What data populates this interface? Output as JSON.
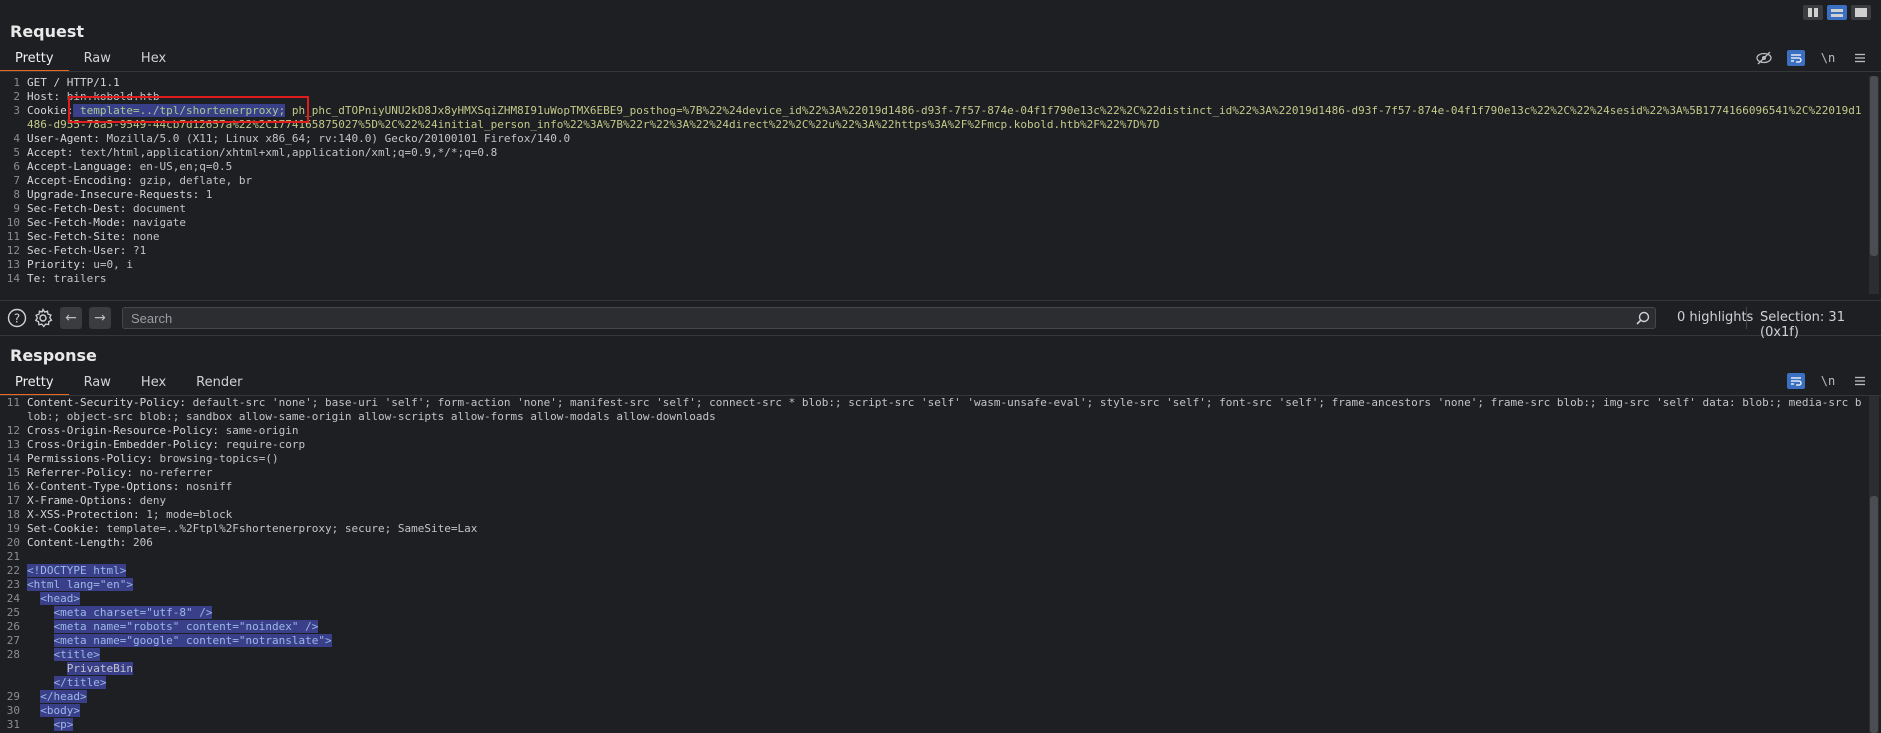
{
  "request": {
    "title": "Request",
    "tabs": [
      "Pretty",
      "Raw",
      "Hex"
    ],
    "active_tab": "Pretty",
    "lines": [
      {
        "n": "1",
        "text": "GET / HTTP/1.1"
      },
      {
        "n": "2",
        "name": "Host:",
        "value": " bin.kobold.htb"
      },
      {
        "n": "3",
        "name": "Cookie:",
        "cookie_highlight": " template=../tpl/shortenerproxy;",
        "cookie_rest": " ph_phc_dTOPniyUNU2kD8Jx8yHMXSqiZHM8I91uWopTMX6EBE9_posthog=%7B%22%24device_id%22%3A%22019d1486-d93f-7f57-874e-04f1f790e13c%22%2C%22distinct_id%22%3A%22019d1486-d93f-7f57-874e-04f1f790e13c%22%2C%22%24sesid%22%3A%5B1774166096541%2C%22019d1486-d955-78a5-9549-44cb7d12657a%22%2C1774165875027%5D%2C%22%24initial_person_info%22%3A%7B%22r%22%3A%22%24direct%22%2C%22u%22%3A%22https%3A%2F%2Fmcp.kobold.htb%2F%22%7D%7D"
      },
      {
        "n": "4",
        "name": "User-Agent:",
        "value": " Mozilla/5.0 (X11; Linux x86_64; rv:140.0) Gecko/20100101 Firefox/140.0"
      },
      {
        "n": "5",
        "name": "Accept:",
        "value": " text/html,application/xhtml+xml,application/xml;q=0.9,*/*;q=0.8"
      },
      {
        "n": "6",
        "name": "Accept-Language:",
        "value": " en-US,en;q=0.5"
      },
      {
        "n": "7",
        "name": "Accept-Encoding:",
        "value": " gzip, deflate, br"
      },
      {
        "n": "8",
        "name": "Upgrade-Insecure-Requests:",
        "value": " 1"
      },
      {
        "n": "9",
        "name": "Sec-Fetch-Dest:",
        "value": " document"
      },
      {
        "n": "10",
        "name": "Sec-Fetch-Mode:",
        "value": " navigate"
      },
      {
        "n": "11",
        "name": "Sec-Fetch-Site:",
        "value": " none"
      },
      {
        "n": "12",
        "name": "Sec-Fetch-User:",
        "value": " ?1"
      },
      {
        "n": "13",
        "name": "Priority:",
        "value": " u=0, i"
      },
      {
        "n": "14",
        "name": "Te:",
        "value": " trailers"
      }
    ]
  },
  "search": {
    "placeholder": "Search",
    "highlights": "0 highlights",
    "selection": "Selection: 31 (0x1f)"
  },
  "response": {
    "title": "Response",
    "tabs": [
      "Pretty",
      "Raw",
      "Hex",
      "Render"
    ],
    "active_tab": "Pretty",
    "lines": [
      {
        "n": "11",
        "name": "Content-Security-Policy:",
        "value": " default-src 'none'; base-uri 'self'; form-action 'none'; manifest-src 'self'; connect-src * blob:; script-src 'self' 'wasm-unsafe-eval'; style-src 'self'; font-src 'self'; frame-ancestors 'none'; frame-src blob:; img-src 'self' data: blob:; media-src blob:; object-src blob:; sandbox allow-same-origin allow-scripts allow-forms allow-modals allow-downloads"
      },
      {
        "n": "12",
        "name": "Cross-Origin-Resource-Policy:",
        "value": " same-origin"
      },
      {
        "n": "13",
        "name": "Cross-Origin-Embedder-Policy:",
        "value": " require-corp"
      },
      {
        "n": "14",
        "name": "Permissions-Policy:",
        "value": " browsing-topics=()"
      },
      {
        "n": "15",
        "name": "Referrer-Policy:",
        "value": " no-referrer"
      },
      {
        "n": "16",
        "name": "X-Content-Type-Options:",
        "value": " nosniff"
      },
      {
        "n": "17",
        "name": "X-Frame-Options:",
        "value": " deny"
      },
      {
        "n": "18",
        "name": "X-XSS-Protection:",
        "value": " 1; mode=block"
      },
      {
        "n": "19",
        "name": "Set-Cookie:",
        "value": " template=..%2Ftpl%2Fshortenerproxy; secure; SameSite=Lax"
      },
      {
        "n": "20",
        "name": "Content-Length:",
        "value": " 206"
      },
      {
        "n": "21",
        "text": ""
      },
      {
        "n": "22",
        "indent": "",
        "html": "<!DOCTYPE html>"
      },
      {
        "n": "23",
        "indent": "",
        "html": "<html lang=\"en\">"
      },
      {
        "n": "24",
        "indent": "  ",
        "html": "<head>"
      },
      {
        "n": "25",
        "indent": "    ",
        "html": "<meta charset=\"utf-8\" />"
      },
      {
        "n": "26",
        "indent": "    ",
        "html": "<meta name=\"robots\" content=\"noindex\" />"
      },
      {
        "n": "27",
        "indent": "    ",
        "html": "<meta name=\"google\" content=\"notranslate\">"
      },
      {
        "n": "28",
        "indent": "    ",
        "html": "<title>"
      },
      {
        "n": "",
        "indent": "      ",
        "html": "PrivateBin"
      },
      {
        "n": "",
        "indent": "    ",
        "html": "</title>"
      },
      {
        "n": "29",
        "indent": "  ",
        "html": "</head>"
      },
      {
        "n": "30",
        "indent": "  ",
        "html": "<body>"
      },
      {
        "n": "31",
        "indent": "    ",
        "html": "<p>"
      }
    ]
  },
  "icons": {
    "layout": [
      "layout-split-vertical-icon",
      "layout-split-horizontal-icon",
      "layout-single-icon"
    ],
    "editor_tools": [
      "hide-nonprintable-icon",
      "wrap-lines-icon",
      "newline-icon",
      "menu-icon"
    ]
  }
}
